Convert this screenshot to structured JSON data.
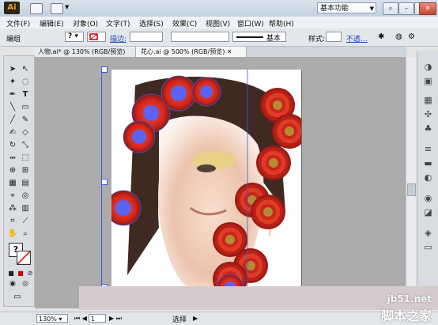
{
  "app": {
    "logo": "Ai"
  },
  "workspace": {
    "label": "基本功能"
  },
  "menu": [
    "文件(F)",
    "编辑(E)",
    "对象(O)",
    "文字(T)",
    "选择(S)",
    "效果(C)",
    "视图(V)",
    "窗口(W)",
    "帮助(H)"
  ],
  "control": {
    "group_label": "编组",
    "fill_label": "?",
    "stroke_label": "描边:",
    "stroke_value": "",
    "brush_label": "基本",
    "style_label": "样式:",
    "opacity_label": "不透..."
  },
  "tabs": [
    {
      "label": "人物.ai* @ 130% (RGB/预览)"
    },
    {
      "label": "花心.ai @ 500% (RGB/预览)"
    }
  ],
  "status": {
    "zoom": "130%",
    "page": "1",
    "mode": "选择"
  },
  "watermark": {
    "url": "jb51.net",
    "cn": "脚本之家"
  },
  "colors": {
    "flower_red": "#d3271e",
    "selection_blue": "#3b5bdb",
    "center_blue": "#5b63f0"
  }
}
